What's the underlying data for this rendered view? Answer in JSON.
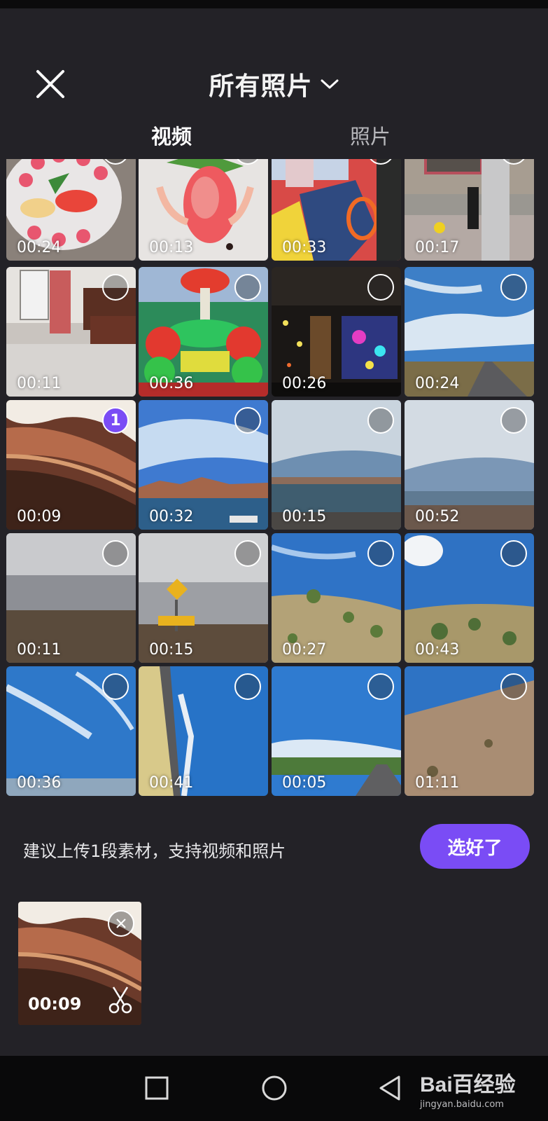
{
  "header": {
    "title": "所有照片",
    "tabs": [
      {
        "label": "视频",
        "active": true
      },
      {
        "label": "照片",
        "active": false
      }
    ]
  },
  "grid": {
    "tiles": [
      {
        "duration": "00:24"
      },
      {
        "duration": "00:13"
      },
      {
        "duration": "00:33"
      },
      {
        "duration": "00:17"
      },
      {
        "duration": "00:11"
      },
      {
        "duration": "00:36"
      },
      {
        "duration": "00:26"
      },
      {
        "duration": "00:24"
      },
      {
        "duration": "00:09",
        "selected_index": "1"
      },
      {
        "duration": "00:32"
      },
      {
        "duration": "00:15"
      },
      {
        "duration": "00:52"
      },
      {
        "duration": "00:11"
      },
      {
        "duration": "00:15"
      },
      {
        "duration": "00:27"
      },
      {
        "duration": "00:43"
      },
      {
        "duration": "00:36"
      },
      {
        "duration": "00:41"
      },
      {
        "duration": "00:05"
      },
      {
        "duration": "01:11"
      }
    ]
  },
  "bottom": {
    "hint": "建议上传1段素材，支持视频和照片",
    "done_label": "选好了",
    "picked": {
      "duration": "00:09"
    }
  },
  "watermark": {
    "logo": "Bai百经验",
    "url": "jingyan.baidu.com"
  },
  "colors": {
    "accent": "#7a4cf5",
    "background": "#232227"
  }
}
